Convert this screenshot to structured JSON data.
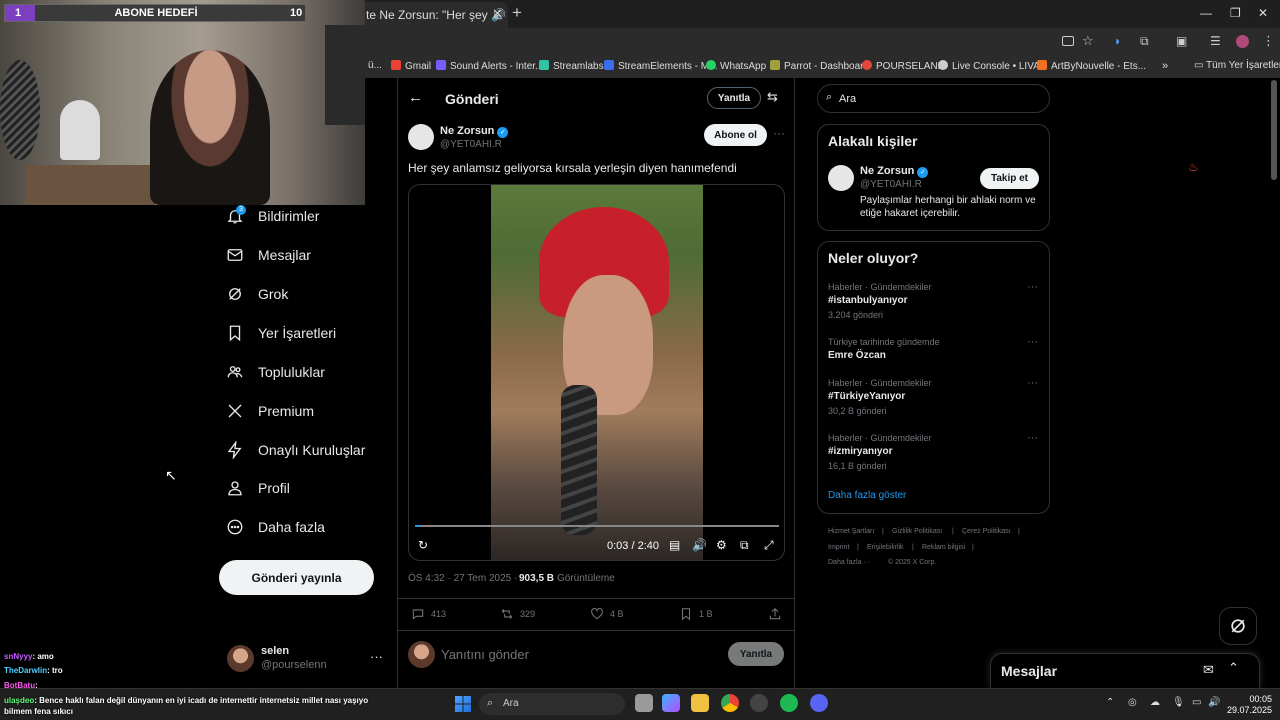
{
  "browser": {
    "tab_title": "te Ne Zorsun: \"Her şey",
    "bookmarks": [
      {
        "label": "Gmail",
        "color": "#ea4335"
      },
      {
        "label": "Sound Alerts - Inter...",
        "color": "#e04848"
      },
      {
        "label": "Streamlabs",
        "color": "#31c3a2"
      },
      {
        "label": "StreamElements - M...",
        "color": "#3b6df0"
      },
      {
        "label": "WhatsApp",
        "color": "#25d366"
      },
      {
        "label": "Parrot - Dashboard",
        "color": "#a0a040"
      },
      {
        "label": "POURSELAND",
        "color": "#e0483a"
      },
      {
        "label": "Live Console • LIVAD",
        "color": "#cccccc"
      },
      {
        "label": "ArtByNouvelle - Ets...",
        "color": "#f07020"
      }
    ],
    "all_bookmarks": "Tüm Yer İşaretleri"
  },
  "stream_overlay": {
    "goal_start": "1",
    "goal_title": "ABONE HEDEFİ",
    "goal_end": "10",
    "goal_progress": 0.1
  },
  "nav": {
    "notification_badge": "3",
    "items": [
      {
        "label": "Bildirimler",
        "icon": "bell-icon"
      },
      {
        "label": "Mesajlar",
        "icon": "mail-icon"
      },
      {
        "label": "Grok",
        "icon": "grok-icon"
      },
      {
        "label": "Yer İşaretleri",
        "icon": "bookmark-icon"
      },
      {
        "label": "Topluluklar",
        "icon": "communities-icon"
      },
      {
        "label": "Premium",
        "icon": "x-logo-icon"
      },
      {
        "label": "Onaylı Kuruluşlar",
        "icon": "lightning-icon"
      },
      {
        "label": "Profil",
        "icon": "person-icon"
      },
      {
        "label": "Daha fazla",
        "icon": "more-circle-icon"
      }
    ],
    "post_button": "Gönderi yayınla",
    "profile_name": "selen",
    "profile_handle": "@pourselenn",
    "profile_more": "···"
  },
  "post": {
    "header_title": "Gönderi",
    "reply_top": "Yanıtla",
    "author_name": "Ne Zorsun",
    "author_handle": "@YET0AHI.R",
    "follow": "Abone ol",
    "more": "···",
    "text": "Her şey anlamsız geliyorsa kırsala yerleşin diyen hanımefendi",
    "video_time": "0:03 / 2:40",
    "video_progress": 0.0125,
    "timestamp": "ÖS 4:32 · 27 Tem 2025 ·",
    "views": "903,5 B",
    "views_label": "Görüntüleme",
    "replies": "413",
    "reposts": "329",
    "likes": "4 B",
    "bookmarks": "1 B",
    "reply_placeholder": "Yanıtını gönder",
    "reply_button": "Yanıtla"
  },
  "right": {
    "search_placeholder": "Ara",
    "related_title": "Alakalı kişiler",
    "related_name": "Ne Zorsun",
    "related_handle": "@YET0AHI.R",
    "related_follow": "Takip et",
    "related_bio": "Paylaşımlar herhangi bir ahlaki norm ve etiğe hakaret içerebilir.",
    "trends_title": "Neler oluyor?",
    "trends": [
      {
        "category": "Haberler · Gündemdekiler",
        "name": "#istanbulyanıyor",
        "count": "3.204 gönderi"
      },
      {
        "category": "Türkiye tarihinde gündemde",
        "name": "Emre Özcan",
        "count": ""
      },
      {
        "category": "Haberler · Gündemdekiler",
        "name": "#TürkiyeYanıyor",
        "count": "30,2 B gönderi"
      },
      {
        "category": "Haberler · Gündemdekiler",
        "name": "#izmiryanıyor",
        "count": "16,1 B gönderi"
      }
    ],
    "show_more": "Daha fazla göster",
    "footer": [
      "Hizmet Şartları",
      "|",
      "Gizlilik Politikası",
      "|",
      "Çerez Politikası",
      "|",
      "Imprint",
      "|",
      "Erişilebilirlik",
      "|",
      "Reklam bilgisi",
      "|",
      "Daha fazla ···",
      "© 2025 X Corp."
    ],
    "messages_title": "Mesajlar"
  },
  "chat": [
    {
      "user": "snNyyy",
      "text": ": amo",
      "color": "#c45cff"
    },
    {
      "user": "TheDarwlin",
      "text": ": tro",
      "color": "#4fd1ff"
    },
    {
      "user": "BotBatu",
      "text": ":",
      "color": "#ff5cf0"
    },
    {
      "user": "ulaşdeo",
      "text": ": Bence haklı falan değil dünyanın en iyi icadı de internettir internetsiz millet nası yaşıyo",
      "color": "#5cff7a"
    },
    {
      "user": "",
      "text": "bilmem fena sıkıcı",
      "color": "#ffffff"
    }
  ],
  "taskbar": {
    "search": "Ara",
    "time": "00:05",
    "date": "29.07.2025"
  }
}
